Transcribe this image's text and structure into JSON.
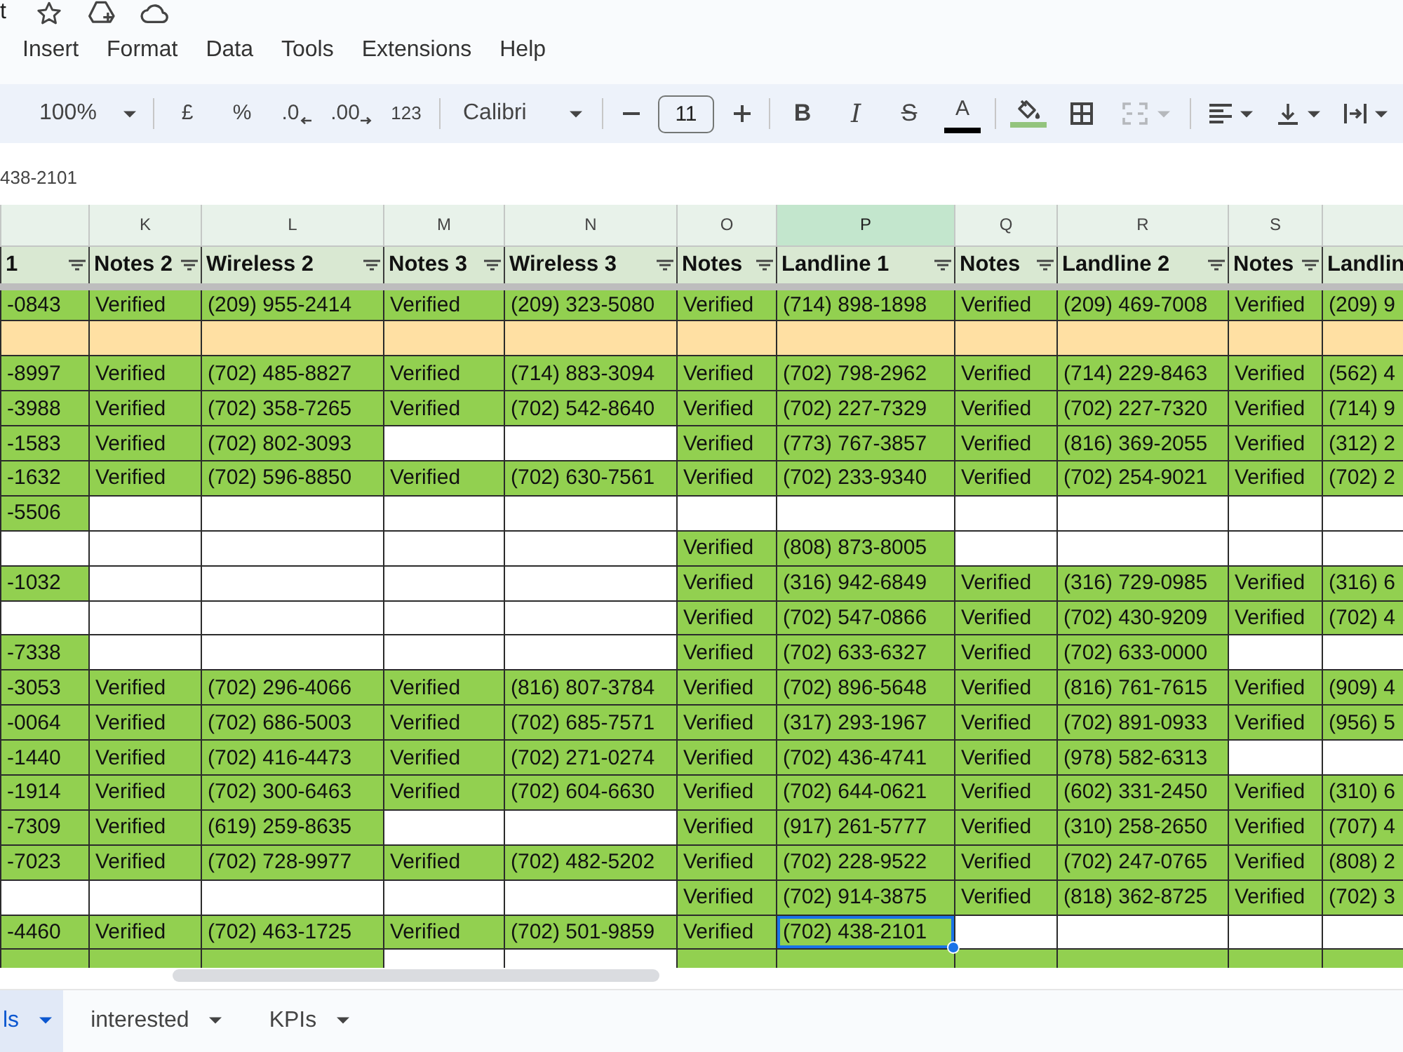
{
  "document": {
    "title": "t"
  },
  "menu": [
    "Insert",
    "Format",
    "Data",
    "Tools",
    "Extensions",
    "Help"
  ],
  "toolbar": {
    "zoom": "100%",
    "number_buttons": [
      {
        "kind": "currency",
        "label": "£"
      },
      {
        "kind": "percent",
        "label": "%"
      },
      {
        "kind": "decrease_decimals",
        "label": ".0"
      },
      {
        "kind": "increase_decimals",
        "label": ".00"
      },
      {
        "kind": "number_format",
        "label": "123"
      }
    ],
    "font": "Calibri",
    "font_size": "11",
    "text_buttons": [
      {
        "kind": "bold",
        "label": "B"
      },
      {
        "kind": "italic",
        "label": "I"
      },
      {
        "kind": "strikethrough",
        "label": "S"
      },
      {
        "kind": "text_color",
        "label": "A",
        "color": "#000000"
      }
    ],
    "fill_button": {
      "color": "#93c47d"
    },
    "merge_disabled": true
  },
  "formula_bar": {
    "value": "438-2101"
  },
  "table": {
    "columns": [
      {
        "header": "1",
        "filter": true,
        "selected": false
      },
      {
        "letter": "K",
        "header": "Notes 2",
        "filter": true,
        "selected": false
      },
      {
        "letter": "L",
        "header": "Wireless 2",
        "filter": true,
        "selected": false
      },
      {
        "letter": "M",
        "header": "Notes 3",
        "filter": true,
        "selected": false
      },
      {
        "letter": "N",
        "header": "Wireless 3",
        "filter": true,
        "selected": false
      },
      {
        "letter": "O",
        "header": "Notes",
        "filter": true,
        "selected": false
      },
      {
        "letter": "P",
        "header": "Landline 1",
        "filter": true,
        "selected": true
      },
      {
        "letter": "Q",
        "header": "Notes",
        "filter": true,
        "selected": false
      },
      {
        "letter": "R",
        "header": "Landline 2",
        "filter": true,
        "selected": false
      },
      {
        "letter": "S",
        "header": "Notes",
        "filter": true,
        "selected": false
      },
      {
        "header": "Landlin",
        "selected": false
      }
    ],
    "rows": [
      {
        "kind": "data",
        "color": "#92d050",
        "cells": [
          "-0843",
          "Verified",
          "(209) 955-2414",
          "Verified",
          "(209) 323-5080",
          "Verified",
          "(714) 898-1898",
          "Verified",
          "(209) 469-7008",
          "Verified",
          "(209) 9"
        ]
      },
      {
        "kind": "highlight",
        "color": "#ffe0a3"
      },
      {
        "kind": "data",
        "color": "#92d050",
        "cells": [
          "-8997",
          "Verified",
          "(702) 485-8827",
          "Verified",
          "(714) 883-3094",
          "Verified",
          "(702) 798-2962",
          "Verified",
          "(714) 229-8463",
          "Verified",
          "(562) 4"
        ]
      },
      {
        "kind": "data",
        "color": "#92d050",
        "cells": [
          "-3988",
          "Verified",
          "(702) 358-7265",
          "Verified",
          "(702) 542-8640",
          "Verified",
          "(702) 227-7329",
          "Verified",
          "(702) 227-7320",
          "Verified",
          "(714) 9"
        ]
      },
      {
        "kind": "data",
        "color": "#92d050",
        "cells": [
          "-1583",
          "Verified",
          "(702) 802-3093",
          null,
          null,
          "Verified",
          "(773) 767-3857",
          "Verified",
          "(816) 369-2055",
          "Verified",
          "(312) 2"
        ]
      },
      {
        "kind": "data",
        "color": "#92d050",
        "cells": [
          "-1632",
          "Verified",
          "(702) 596-8850",
          "Verified",
          "(702) 630-7561",
          "Verified",
          "(702) 233-9340",
          "Verified",
          "(702) 254-9021",
          "Verified",
          "(702) 2"
        ]
      },
      {
        "kind": "data",
        "color": "#92d050",
        "cells": [
          "-5506",
          null,
          null,
          null,
          null,
          null,
          null,
          null,
          null,
          null,
          null
        ]
      },
      {
        "kind": "data",
        "color": "#92d050",
        "cells": [
          null,
          null,
          null,
          null,
          null,
          "Verified",
          "(808) 873-8005",
          null,
          null,
          null,
          null
        ]
      },
      {
        "kind": "data",
        "color": "#92d050",
        "cells": [
          "-1032",
          null,
          null,
          null,
          null,
          "Verified",
          "(316) 942-6849",
          "Verified",
          "(316) 729-0985",
          "Verified",
          "(316) 6"
        ]
      },
      {
        "kind": "data",
        "color": "#92d050",
        "cells": [
          null,
          null,
          null,
          null,
          null,
          "Verified",
          "(702) 547-0866",
          "Verified",
          "(702) 430-9209",
          "Verified",
          "(702) 4"
        ]
      },
      {
        "kind": "data",
        "color": "#92d050",
        "cells": [
          "-7338",
          null,
          null,
          null,
          null,
          "Verified",
          "(702) 633-6327",
          "Verified",
          "(702) 633-0000",
          null,
          null
        ]
      },
      {
        "kind": "data",
        "color": "#92d050",
        "cells": [
          "-3053",
          "Verified",
          "(702) 296-4066",
          "Verified",
          "(816) 807-3784",
          "Verified",
          "(702) 896-5648",
          "Verified",
          "(816) 761-7615",
          "Verified",
          "(909) 4"
        ]
      },
      {
        "kind": "data",
        "color": "#92d050",
        "cells": [
          "-0064",
          "Verified",
          "(702) 686-5003",
          "Verified",
          "(702) 685-7571",
          "Verified",
          "(317) 293-1967",
          "Verified",
          "(702) 891-0933",
          "Verified",
          "(956) 5"
        ]
      },
      {
        "kind": "data",
        "color": "#92d050",
        "cells": [
          "-1440",
          "Verified",
          "(702) 416-4473",
          "Verified",
          "(702) 271-0274",
          "Verified",
          "(702) 436-4741",
          "Verified",
          "(978) 582-6313",
          null,
          null
        ]
      },
      {
        "kind": "data",
        "color": "#92d050",
        "cells": [
          "-1914",
          "Verified",
          "(702) 300-6463",
          "Verified",
          "(702) 604-6630",
          "Verified",
          "(702) 644-0621",
          "Verified",
          "(602) 331-2450",
          "Verified",
          "(310) 6"
        ]
      },
      {
        "kind": "data",
        "color": "#92d050",
        "cells": [
          "-7309",
          "Verified",
          "(619) 259-8635",
          null,
          null,
          "Verified",
          "(917) 261-5777",
          "Verified",
          "(310) 258-2650",
          "Verified",
          "(707) 4"
        ]
      },
      {
        "kind": "data",
        "color": "#92d050",
        "cells": [
          "-7023",
          "Verified",
          "(702) 728-9977",
          "Verified",
          "(702) 482-5202",
          "Verified",
          "(702) 228-9522",
          "Verified",
          "(702) 247-0765",
          "Verified",
          "(808) 2"
        ]
      },
      {
        "kind": "data",
        "color": "#92d050",
        "cells": [
          null,
          null,
          null,
          null,
          null,
          "Verified",
          "(702) 914-3875",
          "Verified",
          "(818) 362-8725",
          "Verified",
          "(702) 3"
        ]
      },
      {
        "kind": "data",
        "color": "#92d050",
        "cells": [
          "-4460",
          "Verified",
          "(702) 463-1725",
          "Verified",
          "(702) 501-9859",
          "Verified",
          {
            "text": "(702) 438-2101",
            "selected": true
          },
          null,
          null,
          null,
          null
        ]
      },
      {
        "kind": "partial",
        "color": "#92d050",
        "filled": [
          true,
          true,
          true,
          false,
          false,
          true,
          true,
          true,
          true,
          true,
          true
        ]
      }
    ]
  },
  "sheet_tabs": [
    {
      "label": "ls",
      "selected": true
    },
    {
      "label": "interested",
      "selected": false
    },
    {
      "label": "KPIs",
      "selected": false
    }
  ]
}
